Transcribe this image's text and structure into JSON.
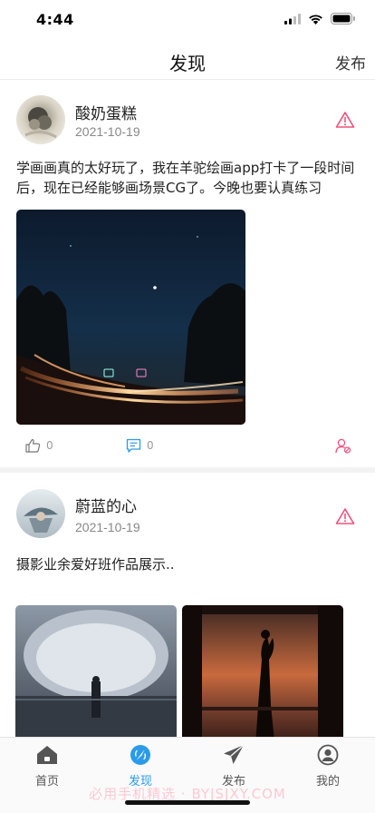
{
  "status_bar": {
    "time": "4:44"
  },
  "nav": {
    "title": "发现",
    "action": "发布"
  },
  "posts": [
    {
      "author": "酸奶蛋糕",
      "date": "2021-10-19",
      "text": "学画画真的太好玩了，我在羊驼绘画app打卡了一段时间后，现在已经能够画场景CG了。今晚也要认真练习",
      "likes": "0",
      "comments": "0"
    },
    {
      "author": "蔚蓝的心",
      "date": "2021-10-19",
      "text": "摄影业余爱好班作品展示.."
    }
  ],
  "tabs": [
    {
      "label": "首页",
      "icon": "home-icon"
    },
    {
      "label": "发现",
      "icon": "discover-icon",
      "active": true
    },
    {
      "label": "发布",
      "icon": "send-icon"
    },
    {
      "label": "我的",
      "icon": "user-icon"
    }
  ],
  "watermark": "必用手机精选 · BYJSJXY.COM",
  "colors": {
    "accent": "#2b9be8",
    "warning": "#f0507a",
    "comment": "#2b9be8"
  }
}
